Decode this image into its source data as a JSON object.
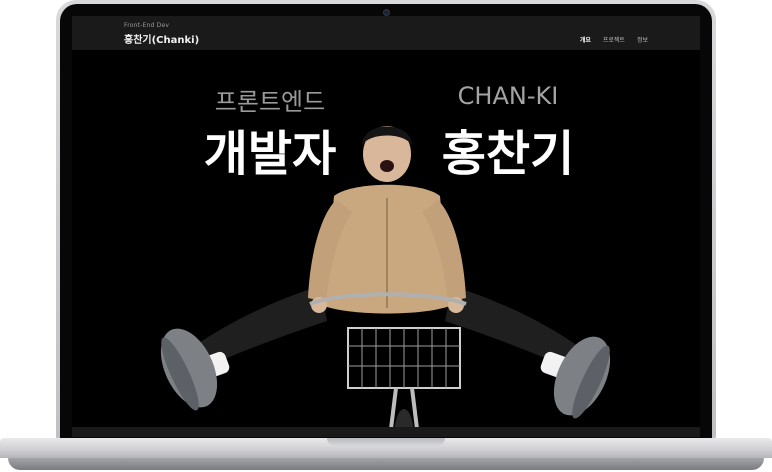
{
  "header": {
    "subtitle": "Front-End Dev",
    "title": "홍찬기(Chanki)",
    "nav": [
      {
        "label": "개요",
        "active": true
      },
      {
        "label": "프로젝트",
        "active": false
      },
      {
        "label": "정보",
        "active": false
      }
    ]
  },
  "hero": {
    "role_sub": "프론트엔드",
    "role_main": "개발자",
    "name_sub": "CHAN-KI",
    "name_main": "홍찬기"
  },
  "colors": {
    "screen_bg": "#000000",
    "navbar_bg": "#1a1a1b",
    "muted_text": "#9a9a9a",
    "jacket": "#c9a77f",
    "pants": "#1f1f1f",
    "shoes": "#7d8186"
  }
}
